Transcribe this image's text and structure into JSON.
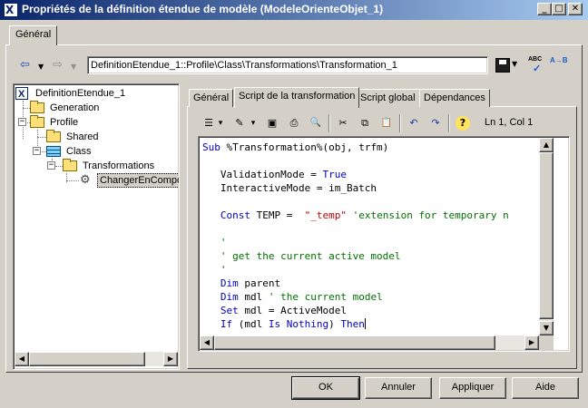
{
  "window": {
    "title": "Propriétés de la définition étendue de modèle (ModeleOrienteObjet_1)",
    "icon_letter": "X",
    "controls": {
      "minimize": "_",
      "maximize": "□",
      "close": "✕"
    }
  },
  "outer_tab": {
    "label": "Général"
  },
  "nav": {
    "back_icon": "⇦",
    "forward_icon": "⇨",
    "dropdown_icon": "▼",
    "path": "DefinitionEtendue_1::Profile\\Class\\Transformations\\Transformation_1",
    "spell_label": "ABC",
    "replace_label": "A→B"
  },
  "tree": {
    "nodes": [
      {
        "label": "DefinitionEtendue_1",
        "icon": "extension-icon"
      },
      {
        "label": "Generation",
        "icon": "folder-icon"
      },
      {
        "label": "Profile",
        "icon": "folder-icon",
        "expander": "−"
      },
      {
        "label": "Shared",
        "icon": "folder-icon"
      },
      {
        "label": "Class",
        "icon": "class-icon",
        "expander": "−"
      },
      {
        "label": "Transformations",
        "icon": "folder-icon",
        "expander": "−"
      },
      {
        "label": "ChangerEnCompo",
        "icon": "gear-icon",
        "selected": true
      }
    ]
  },
  "inner_tabs": [
    {
      "label": "Général"
    },
    {
      "label": "Script de la transformation",
      "active": true
    },
    {
      "label": "Script global"
    },
    {
      "label": "Dépendances"
    }
  ],
  "editor_toolbar": {
    "cursor_position": "Ln 1, Col 1",
    "icons": {
      "properties": "☰",
      "edit": "✎",
      "dropdown": "▾",
      "save": "▣",
      "print": "⎙",
      "find": "🔍",
      "cut": "✂",
      "copy": "⧉",
      "paste": "📋",
      "undo": "↶",
      "redo": "↷",
      "help": "?"
    }
  },
  "code_lines": [
    {
      "parts": [
        {
          "t": "Sub",
          "c": "kw"
        },
        {
          "t": " %Transformation%(obj, trfm)"
        }
      ]
    },
    {
      "parts": []
    },
    {
      "parts": [
        {
          "t": "   ValidationMode = "
        },
        {
          "t": "True",
          "c": "kw"
        }
      ]
    },
    {
      "parts": [
        {
          "t": "   InteractiveMode = im_Batch"
        }
      ]
    },
    {
      "parts": []
    },
    {
      "parts": [
        {
          "t": "   "
        },
        {
          "t": "Const",
          "c": "kw"
        },
        {
          "t": " TEMP =  "
        },
        {
          "t": "\"_temp\"",
          "c": "st"
        },
        {
          "t": " 'extension for temporary n",
          "c": "cm"
        }
      ]
    },
    {
      "parts": []
    },
    {
      "parts": [
        {
          "t": "   '",
          "c": "cm"
        }
      ]
    },
    {
      "parts": [
        {
          "t": "   ' get the current active model",
          "c": "cm"
        }
      ]
    },
    {
      "parts": [
        {
          "t": "   '",
          "c": "cm"
        }
      ]
    },
    {
      "parts": [
        {
          "t": "   "
        },
        {
          "t": "Dim",
          "c": "kw"
        },
        {
          "t": " parent"
        }
      ]
    },
    {
      "parts": [
        {
          "t": "   "
        },
        {
          "t": "Dim",
          "c": "kw"
        },
        {
          "t": " mdl "
        },
        {
          "t": "' the current model",
          "c": "cm"
        }
      ]
    },
    {
      "parts": [
        {
          "t": "   "
        },
        {
          "t": "Set",
          "c": "kw"
        },
        {
          "t": " mdl = ActiveModel"
        }
      ]
    },
    {
      "parts": [
        {
          "t": "   "
        },
        {
          "t": "If",
          "c": "kw"
        },
        {
          "t": " (mdl "
        },
        {
          "t": "Is Nothing",
          "c": "kw"
        },
        {
          "t": ") "
        },
        {
          "t": "Then",
          "c": "kw"
        }
      ]
    }
  ],
  "scroll_arrows": {
    "up": "▲",
    "down": "▼",
    "left": "◀",
    "right": "▶"
  },
  "buttons": {
    "ok": "OK",
    "cancel": "Annuler",
    "apply": "Appliquer",
    "help": "Aide"
  },
  "colors": {
    "titlebar_start": "#0a246a",
    "titlebar_end": "#a6caf0",
    "keyword": "#0000c0",
    "comment": "#007000",
    "string": "#c00000"
  }
}
